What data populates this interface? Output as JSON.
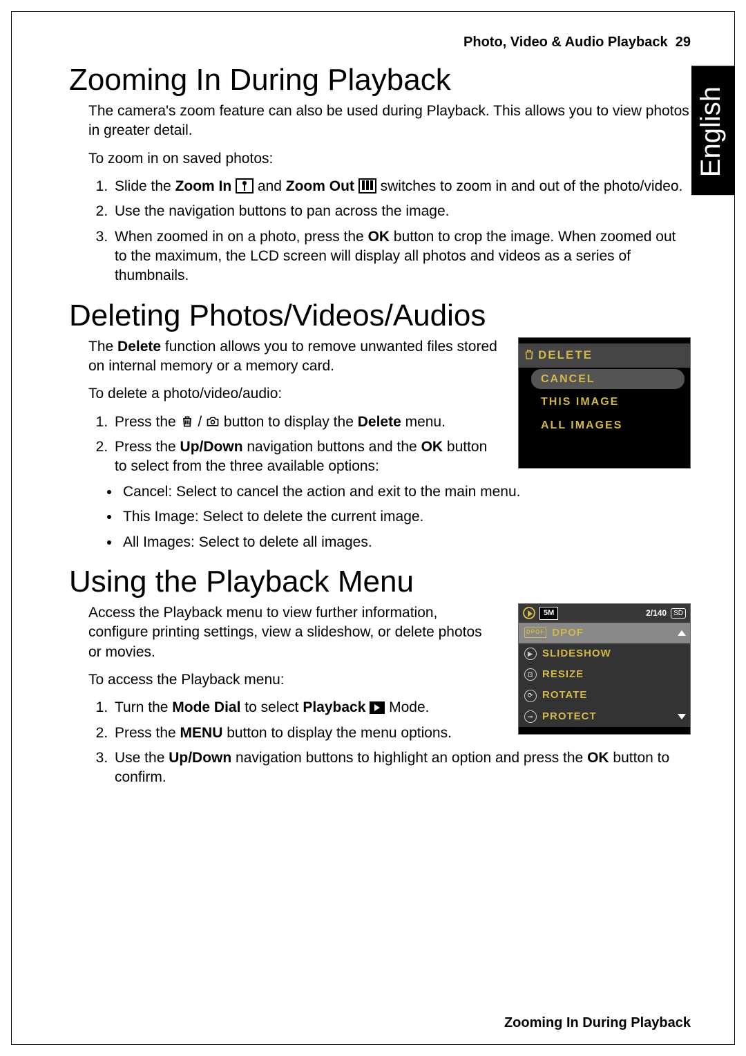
{
  "header": {
    "section": "Photo, Video & Audio Playback",
    "page": "29"
  },
  "language_tab": "English",
  "sections": [
    {
      "heading": "Zooming In During Playback",
      "intro": "The camera's zoom feature can also be used during Playback. This allows you to view photos in greater detail.",
      "lead": "To zoom in on saved photos:",
      "steps": {
        "s1a": "Slide the ",
        "s1b": "Zoom In",
        "s1c": " and ",
        "s1d": "Zoom Out",
        "s1e": " switches to zoom in and out of the photo/video.",
        "s2": "Use the navigation buttons to pan across the image.",
        "s3a": "When zoomed in on a photo, press the ",
        "s3b": "OK",
        "s3c": " button to crop the image. When zoomed out to the maximum, the LCD screen will display all photos and videos as a series of thumbnails."
      }
    },
    {
      "heading": "Deleting Photos/Videos/Audios",
      "para1a": "The ",
      "para1b": "Delete",
      "para1c": " function allows you to remove unwanted files stored on internal memory or a memory card.",
      "lead": "To delete a photo/video/audio:",
      "steps": {
        "s1a": "Press the ",
        "s1b": " button to display the ",
        "s1c": "Delete",
        "s1d": " menu.",
        "s2a": "Press the ",
        "s2b": "Up/Down",
        "s2c": " navigation buttons and the ",
        "s2d": "OK",
        "s2e": " button to select from the three available options:"
      },
      "bullets": {
        "b1": "Cancel: Select to cancel the action and exit to the main menu.",
        "b2": "This Image: Select to delete the current image.",
        "b3": "All Images: Select to delete all images."
      },
      "menu": {
        "title": "DELETE",
        "items": [
          "CANCEL",
          "THIS IMAGE",
          "ALL IMAGES"
        ]
      }
    },
    {
      "heading": "Using the Playback Menu",
      "intro": "Access the Playback menu to view further information, configure printing settings, view a slideshow, or delete photos or movies.",
      "lead": "To access the Playback menu:",
      "steps": {
        "s1a": "Turn the ",
        "s1b": "Mode Dial",
        "s1c": " to select ",
        "s1d": "Playback",
        "s1e": " Mode.",
        "s2a": "Press the ",
        "s2b": "MENU",
        "s2c": " button to display the menu options.",
        "s3a": "Use the ",
        "s3b": "Up/Down",
        "s3c": " navigation buttons to highlight an option and press the ",
        "s3d": "OK",
        "s3e": " button to confirm."
      },
      "menu": {
        "top": {
          "res": "5M",
          "count": "2/140",
          "storage": "SD"
        },
        "items": [
          "DPOF",
          "SLIDESHOW",
          "RESIZE",
          "ROTATE",
          "PROTECT"
        ]
      }
    }
  ],
  "footer": "Zooming In During Playback"
}
